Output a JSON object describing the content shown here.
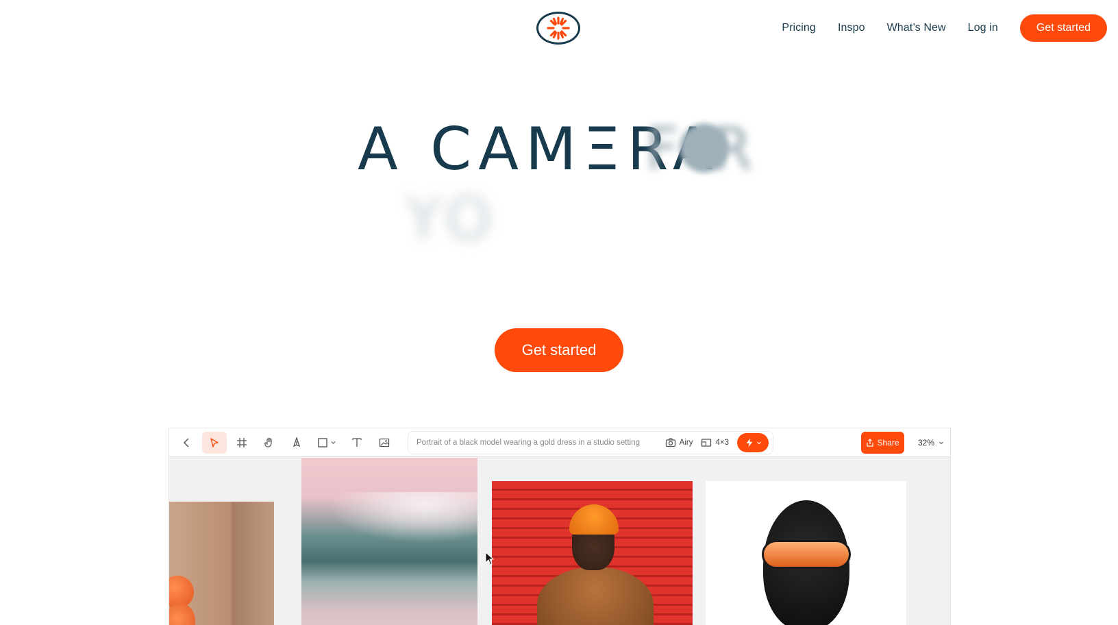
{
  "nav": {
    "links": [
      "Pricing",
      "Inspo",
      "What’s New",
      "Log in"
    ],
    "cta": "Get started"
  },
  "hero": {
    "headline_visible": "A CAMΞRA",
    "headline_blurred_1": "F R",
    "headline_blurred_2": "YO"
  },
  "cta": "Get started",
  "app": {
    "prompt_placeholder": "Portrait of a black model wearing a gold dress in a studio setting",
    "style_chip": "Airy",
    "ratio_chip": "4×3",
    "share_label": "Share",
    "zoom": "32%"
  },
  "colors": {
    "accent": "#ff4a0c",
    "text": "#173a4c",
    "canvas": "#f1f1f1"
  },
  "icons": [
    "sun-logo-icon",
    "back-icon",
    "pointer-icon",
    "frame-icon",
    "hand-icon",
    "pen-icon",
    "rectangle-icon",
    "text-icon",
    "image-icon",
    "camera-icon",
    "aspect-ratio-icon",
    "bolt-icon",
    "share-icon",
    "chevron-down-icon"
  ]
}
